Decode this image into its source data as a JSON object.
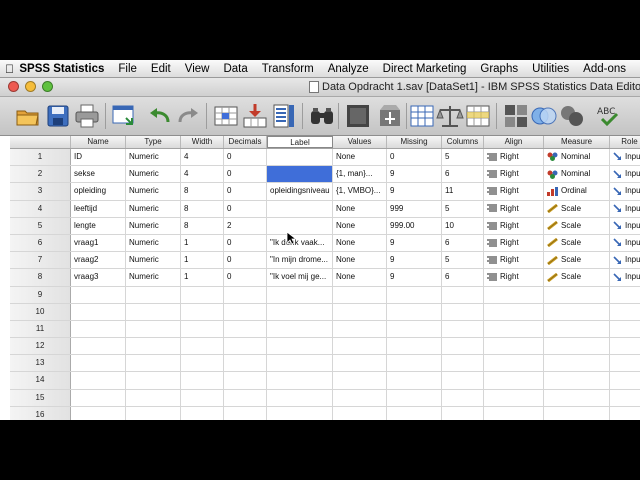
{
  "menubar": {
    "app_name": "SPSS Statistics",
    "items": [
      "File",
      "Edit",
      "View",
      "Data",
      "Transform",
      "Analyze",
      "Direct Marketing",
      "Graphs",
      "Utilities",
      "Add-ons"
    ]
  },
  "window": {
    "title": "Data Opdracht 1.sav [DataSet1] - IBM SPSS Statistics Data Editor"
  },
  "colors": {
    "selection": "#3f6ed9",
    "nominal_icon": "#2a8a3a",
    "ordinal_icon": "#c23b2a",
    "scale_icon": "#c79a1f"
  },
  "toolbar": {
    "icons": [
      "open-icon",
      "save-icon",
      "print-icon",
      "recall-dialog-icon",
      "undo-icon",
      "redo-icon",
      "goto-case-icon",
      "goto-variable-icon",
      "variables-icon",
      "find-icon",
      "insert-cases-icon",
      "insert-variable-icon",
      "split-file-icon",
      "weight-cases-icon",
      "select-cases-icon",
      "value-labels-icon",
      "use-sets-icon",
      "show-all-variables-icon",
      "spell-check-icon"
    ]
  },
  "grid": {
    "columns": [
      "",
      "Name",
      "Type",
      "Width",
      "Decimals",
      "Label",
      "Values",
      "Missing",
      "Columns",
      "Align",
      "Measure",
      "Role"
    ],
    "rows": [
      {
        "n": "1",
        "name": "ID",
        "type": "Numeric",
        "width": "4",
        "decimals": "0",
        "label": "",
        "values": "None",
        "missing": "0",
        "columns": "5",
        "align": "Right",
        "measure": "Nominal",
        "role": "Input"
      },
      {
        "n": "2",
        "name": "sekse",
        "type": "Numeric",
        "width": "4",
        "decimals": "0",
        "label": "",
        "values": "{1, man}...",
        "missing": "9",
        "columns": "6",
        "align": "Right",
        "measure": "Nominal",
        "role": "Input"
      },
      {
        "n": "3",
        "name": "opleiding",
        "type": "Numeric",
        "width": "8",
        "decimals": "0",
        "label": "opleidingsniveau",
        "values": "{1, VMBO}...",
        "missing": "9",
        "columns": "11",
        "align": "Right",
        "measure": "Ordinal",
        "role": "Input"
      },
      {
        "n": "4",
        "name": "leeftijd",
        "type": "Numeric",
        "width": "8",
        "decimals": "0",
        "label": "",
        "values": "None",
        "missing": "999",
        "columns": "5",
        "align": "Right",
        "measure": "Scale",
        "role": "Input"
      },
      {
        "n": "5",
        "name": "lengte",
        "type": "Numeric",
        "width": "8",
        "decimals": "2",
        "label": "",
        "values": "None",
        "missing": "999.00",
        "columns": "10",
        "align": "Right",
        "measure": "Scale",
        "role": "Input"
      },
      {
        "n": "6",
        "name": "vraag1",
        "type": "Numeric",
        "width": "1",
        "decimals": "0",
        "label": "\"Ik denk vaak...",
        "values": "None",
        "missing": "9",
        "columns": "6",
        "align": "Right",
        "measure": "Scale",
        "role": "Input"
      },
      {
        "n": "7",
        "name": "vraag2",
        "type": "Numeric",
        "width": "1",
        "decimals": "0",
        "label": "\"In mijn drome...",
        "values": "None",
        "missing": "9",
        "columns": "5",
        "align": "Right",
        "measure": "Scale",
        "role": "Input"
      },
      {
        "n": "8",
        "name": "vraag3",
        "type": "Numeric",
        "width": "1",
        "decimals": "0",
        "label": "\"Ik voel mij ge...",
        "values": "None",
        "missing": "9",
        "columns": "6",
        "align": "Right",
        "measure": "Scale",
        "role": "Input"
      }
    ],
    "empty_rows": [
      "9",
      "10",
      "11",
      "12",
      "13",
      "14",
      "15",
      "16"
    ]
  }
}
